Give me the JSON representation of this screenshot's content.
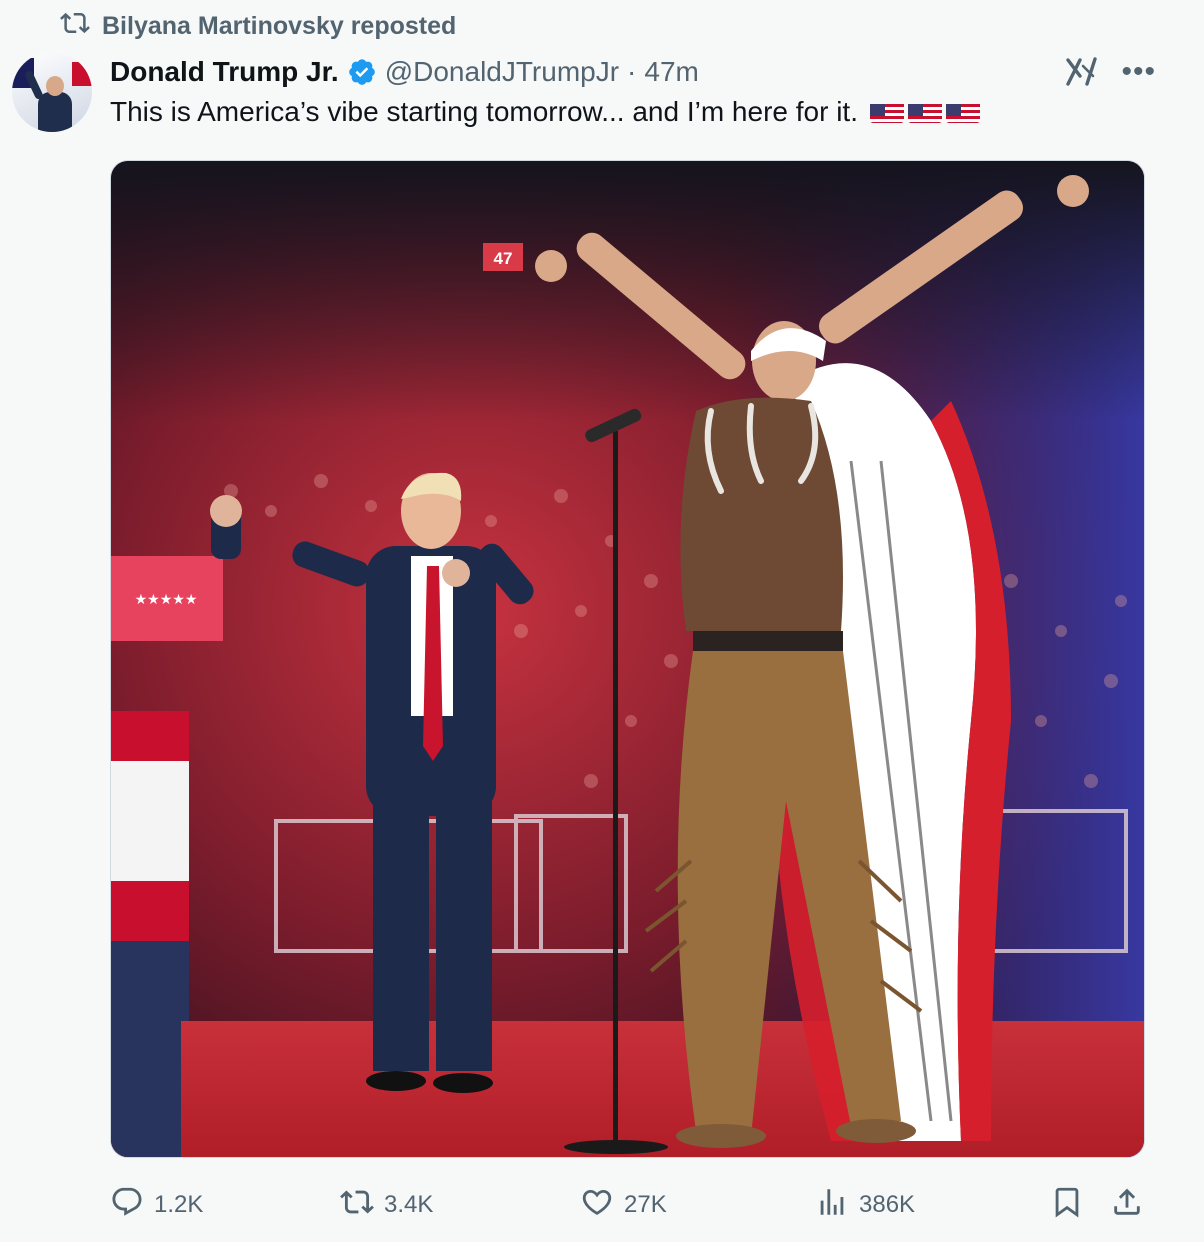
{
  "repost": {
    "text": "Bilyana Martinovsky reposted",
    "icon": "repost-icon"
  },
  "author": {
    "name": "Donald Trump Jr.",
    "handle": "@DonaldJTrumpJr",
    "separator": "·",
    "time": "47m",
    "verified": true,
    "verified_color": "#1d9bf0"
  },
  "tweet": {
    "text": "This is America’s vibe starting tomorrow... and I’m here for it.",
    "emoji": [
      "us-flag",
      "us-flag",
      "us-flag"
    ]
  },
  "media": {
    "sign_text": "47"
  },
  "actions": {
    "replies": "1.2K",
    "reposts": "3.4K",
    "likes": "27K",
    "views": "386K"
  },
  "colors": {
    "secondary_text": "#536471",
    "primary_text": "#0f1419",
    "accent": "#1d9bf0"
  }
}
